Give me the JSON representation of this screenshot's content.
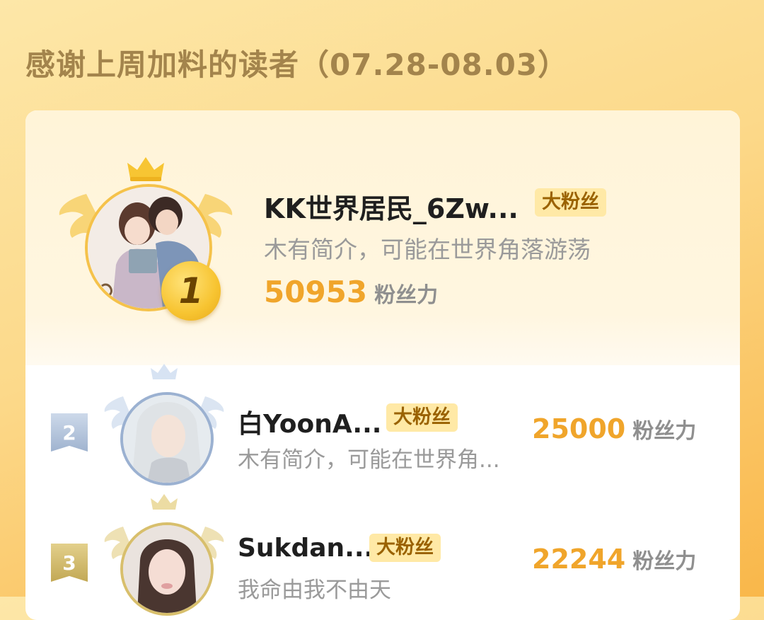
{
  "page": {
    "title": "感谢上周加料的读者（07.28-08.03）"
  },
  "readers": [
    {
      "rank": "1",
      "name": "KK世界居民_6Zw...",
      "tag": "大粉丝",
      "intro": "木有简介，可能在世界角落游荡",
      "score": "50953",
      "score_unit": "粉丝力"
    },
    {
      "rank": "2",
      "name": "白YoonA...",
      "tag": "大粉丝",
      "intro": "木有简介，可能在世界角...",
      "score": "25000",
      "score_unit": "粉丝力"
    },
    {
      "rank": "3",
      "name": "Sukdan...",
      "tag": "大粉丝",
      "intro": "我命由我不由天",
      "score": "22244",
      "score_unit": "粉丝力"
    }
  ],
  "colors": {
    "accent": "#f0a52b",
    "gold": "#f5c24a",
    "silver": "#9fb3cf",
    "bronze": "#c2a854",
    "tag_bg": "#ffe9a6"
  }
}
